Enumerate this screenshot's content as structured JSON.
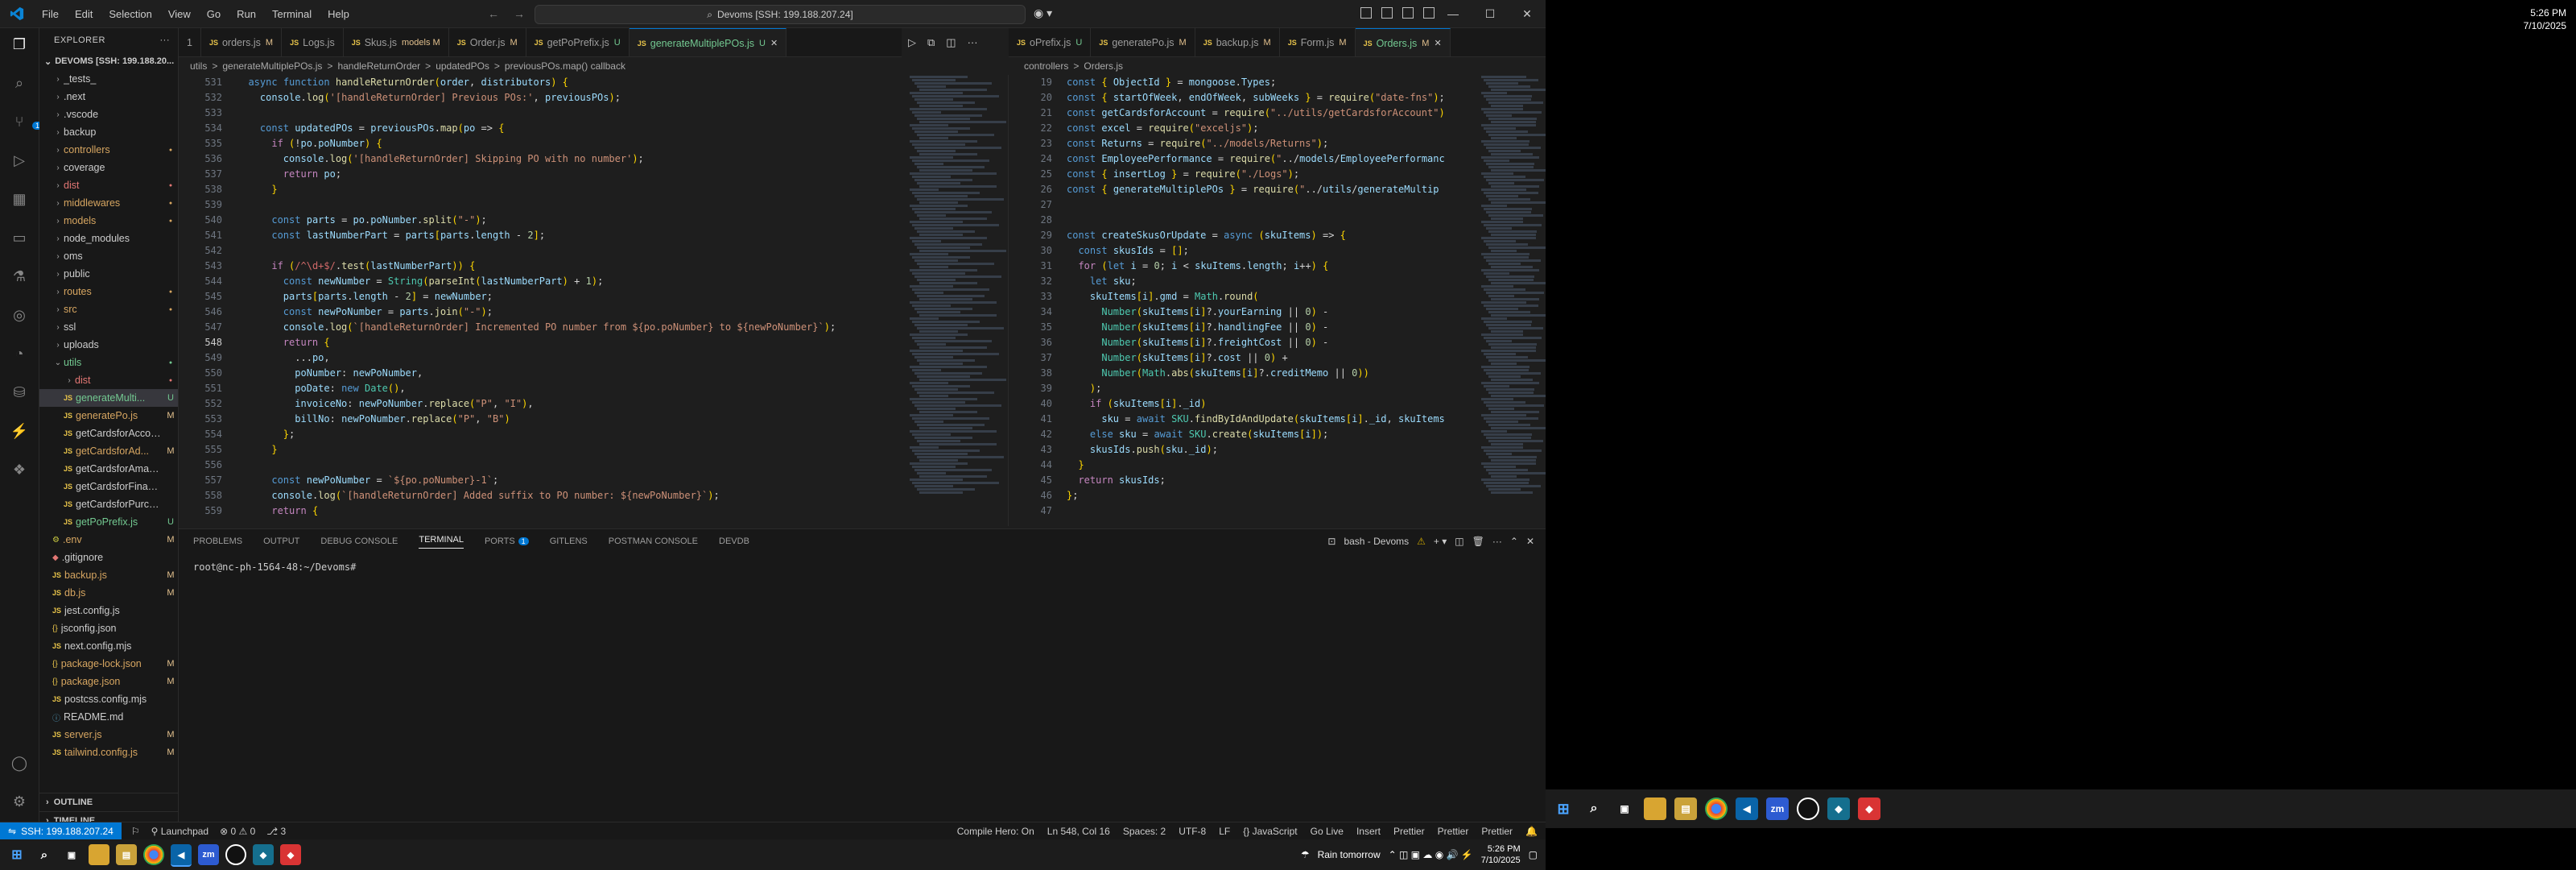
{
  "titlebar": {
    "menu": [
      "File",
      "Edit",
      "Selection",
      "View",
      "Go",
      "Run",
      "Terminal",
      "Help"
    ],
    "command_center": "Devoms [SSH: 199.188.207.24]"
  },
  "activity_badge": "1",
  "explorer": {
    "header": "EXPLORER",
    "root": "DEVOMS [SSH: 199.188.20...",
    "items": [
      {
        "label": "_tests_",
        "type": "folder",
        "status": ""
      },
      {
        "label": ".next",
        "type": "folder",
        "status": ""
      },
      {
        "label": ".vscode",
        "type": "folder",
        "status": ""
      },
      {
        "label": "backup",
        "type": "folder",
        "status": ""
      },
      {
        "label": "controllers",
        "type": "folder",
        "status": "",
        "color": "orange"
      },
      {
        "label": "coverage",
        "type": "folder",
        "status": ""
      },
      {
        "label": "dist",
        "type": "folder",
        "status": "",
        "color": "red"
      },
      {
        "label": "middlewares",
        "type": "folder",
        "status": "",
        "color": "orange"
      },
      {
        "label": "models",
        "type": "folder",
        "status": "",
        "color": "orange"
      },
      {
        "label": "node_modules",
        "type": "folder",
        "status": ""
      },
      {
        "label": "oms",
        "type": "folder",
        "status": ""
      },
      {
        "label": "public",
        "type": "folder",
        "status": ""
      },
      {
        "label": "routes",
        "type": "folder",
        "status": "",
        "color": "orange"
      },
      {
        "label": "src",
        "type": "folder",
        "status": "",
        "color": "orange"
      },
      {
        "label": "ssl",
        "type": "folder",
        "status": ""
      },
      {
        "label": "uploads",
        "type": "folder",
        "status": ""
      },
      {
        "label": "utils",
        "type": "folder",
        "status": "",
        "color": "green",
        "open": true
      },
      {
        "label": "dist",
        "type": "folder",
        "status": "",
        "indent": 1,
        "color": "red"
      },
      {
        "label": "generateMulti...",
        "type": "js",
        "status": "U",
        "indent": 1,
        "selected": true,
        "color": "green"
      },
      {
        "label": "generatePo.js",
        "type": "js",
        "status": "M",
        "indent": 1,
        "color": "orange"
      },
      {
        "label": "getCardsforAccount.js",
        "type": "js",
        "status": "",
        "indent": 1
      },
      {
        "label": "getCardsforAd...",
        "type": "js",
        "status": "M",
        "indent": 1,
        "color": "orange"
      },
      {
        "label": "getCardsforAmazon.js",
        "type": "js",
        "status": "",
        "indent": 1
      },
      {
        "label": "getCardsforFinance.js",
        "type": "js",
        "status": "",
        "indent": 1
      },
      {
        "label": "getCardsforPurchasi...",
        "type": "js",
        "status": "",
        "indent": 1
      },
      {
        "label": "getPoPrefix.js",
        "type": "js",
        "status": "U",
        "indent": 1,
        "color": "green"
      },
      {
        "label": ".env",
        "type": "env",
        "status": "M",
        "color": "orange"
      },
      {
        "label": ".gitignore",
        "type": "git",
        "status": ""
      },
      {
        "label": "backup.js",
        "type": "js",
        "status": "M",
        "color": "orange"
      },
      {
        "label": "db.js",
        "type": "js",
        "status": "M",
        "color": "orange"
      },
      {
        "label": "jest.config.js",
        "type": "js",
        "status": ""
      },
      {
        "label": "jsconfig.json",
        "type": "json",
        "status": ""
      },
      {
        "label": "next.config.mjs",
        "type": "js",
        "status": ""
      },
      {
        "label": "package-lock.json",
        "type": "json",
        "status": "M",
        "color": "orange"
      },
      {
        "label": "package.json",
        "type": "json",
        "status": "M",
        "color": "orange"
      },
      {
        "label": "postcss.config.mjs",
        "type": "js",
        "status": ""
      },
      {
        "label": "README.md",
        "type": "md",
        "status": ""
      },
      {
        "label": "server.js",
        "type": "js",
        "status": "M",
        "color": "orange"
      },
      {
        "label": "tailwind.config.js",
        "type": "js",
        "status": "M",
        "color": "orange"
      }
    ],
    "outline": "OUTLINE",
    "timeline": "TIMELINE"
  },
  "left_editor": {
    "tabs": [
      {
        "label": "1",
        "status": ""
      },
      {
        "label": "orders.js",
        "status": "M"
      },
      {
        "label": "Logs.js",
        "status": ""
      },
      {
        "label": "Skus.js",
        "status": "models M"
      },
      {
        "label": "Order.js",
        "status": "M"
      },
      {
        "label": "getPoPrefix.js",
        "status": "U"
      },
      {
        "label": "generateMultiplePOs.js",
        "status": "U",
        "active": true
      }
    ],
    "breadcrumb": [
      "utils",
      ">",
      "generateMultiplePOs.js",
      ">",
      "handleReturnOrder",
      ">",
      "updatedPOs",
      ">",
      "previousPOs.map() callback"
    ],
    "lines": [
      {
        "n": "531",
        "t": "  async function handleReturnOrder(order, distributors) {"
      },
      {
        "n": "532",
        "t": "    console.log('[handleReturnOrder] Previous POs:', previousPOs);"
      },
      {
        "n": "533",
        "t": ""
      },
      {
        "n": "534",
        "t": "    const updatedPOs = previousPOs.map(po => {"
      },
      {
        "n": "535",
        "t": "      if (!po.poNumber) {"
      },
      {
        "n": "536",
        "t": "        console.log('[handleReturnOrder] Skipping PO with no number');"
      },
      {
        "n": "537",
        "t": "        return po;"
      },
      {
        "n": "538",
        "t": "      }"
      },
      {
        "n": "539",
        "t": ""
      },
      {
        "n": "540",
        "t": "      const parts = po.poNumber.split(\"-\");"
      },
      {
        "n": "541",
        "t": "      const lastNumberPart = parts[parts.length - 2];"
      },
      {
        "n": "542",
        "t": ""
      },
      {
        "n": "543",
        "t": "      if (/^\\d+$/.test(lastNumberPart)) {"
      },
      {
        "n": "544",
        "t": "        const newNumber = String(parseInt(lastNumberPart) + 1);"
      },
      {
        "n": "545",
        "t": "        parts[parts.length - 2] = newNumber;"
      },
      {
        "n": "546",
        "t": "        const newPoNumber = parts.join(\"-\");"
      },
      {
        "n": "547",
        "t": "        console.log(`[handleReturnOrder] Incremented PO number from ${po.poNumber} to ${newPoNumber}`);"
      },
      {
        "n": "548",
        "t": "        return {"
      },
      {
        "n": "549",
        "t": "          ...po,"
      },
      {
        "n": "550",
        "t": "          poNumber: newPoNumber,"
      },
      {
        "n": "551",
        "t": "          poDate: new Date(),"
      },
      {
        "n": "552",
        "t": "          invoiceNo: newPoNumber.replace(\"P\", \"I\"),"
      },
      {
        "n": "553",
        "t": "          billNo: newPoNumber.replace(\"P\", \"B\")"
      },
      {
        "n": "554",
        "t": "        };"
      },
      {
        "n": "555",
        "t": "      }"
      },
      {
        "n": "556",
        "t": ""
      },
      {
        "n": "557",
        "t": "      const newPoNumber = `${po.poNumber}-1`;"
      },
      {
        "n": "558",
        "t": "      console.log(`[handleReturnOrder] Added suffix to PO number: ${newPoNumber}`);"
      },
      {
        "n": "559",
        "t": "      return {"
      }
    ]
  },
  "right_editor": {
    "tabs": [
      {
        "label": "oPrefix.js",
        "status": "U"
      },
      {
        "label": "generatePo.js",
        "status": "M"
      },
      {
        "label": "backup.js",
        "status": "M"
      },
      {
        "label": "Form.js",
        "status": "M"
      },
      {
        "label": "Orders.js",
        "status": "M",
        "active": true
      }
    ],
    "breadcrumb": [
      "controllers",
      ">",
      "Orders.js"
    ],
    "lines": [
      {
        "n": "19",
        "t": "const { ObjectId } = mongoose.Types;"
      },
      {
        "n": "20",
        "t": "const { startOfWeek, endOfWeek, subWeeks } = require(\"date-fns\");"
      },
      {
        "n": "21",
        "t": "const getCardsforAccount = require(\"../utils/getCardsforAccount\")"
      },
      {
        "n": "22",
        "t": "const excel = require(\"exceljs\");"
      },
      {
        "n": "23",
        "t": "const Returns = require(\"../models/Returns\");"
      },
      {
        "n": "24",
        "t": "const EmployeePerformance = require(\"../models/EmployeePerformanc"
      },
      {
        "n": "25",
        "t": "const { insertLog } = require(\"./Logs\");"
      },
      {
        "n": "26",
        "t": "const { generateMultiplePOs } = require(\"../utils/generateMultip"
      },
      {
        "n": "27",
        "t": ""
      },
      {
        "n": "28",
        "t": ""
      },
      {
        "n": "29",
        "t": "const createSkusOrUpdate = async (skuItems) => {"
      },
      {
        "n": "30",
        "t": "  const skusIds = [];"
      },
      {
        "n": "31",
        "t": "  for (let i = 0; i < skuItems.length; i++) {"
      },
      {
        "n": "32",
        "t": "    let sku;"
      },
      {
        "n": "33",
        "t": "    skuItems[i].gmd = Math.round("
      },
      {
        "n": "34",
        "t": "      Number(skuItems[i]?.yourEarning || 0) -"
      },
      {
        "n": "35",
        "t": "      Number(skuItems[i]?.handlingFee || 0) -"
      },
      {
        "n": "36",
        "t": "      Number(skuItems[i]?.freightCost || 0) -"
      },
      {
        "n": "37",
        "t": "      Number(skuItems[i]?.cost || 0) +"
      },
      {
        "n": "38",
        "t": "      Number(Math.abs(skuItems[i]?.creditMemo || 0))"
      },
      {
        "n": "39",
        "t": "    );"
      },
      {
        "n": "40",
        "t": "    if (skuItems[i]._id)"
      },
      {
        "n": "41",
        "t": "      sku = await SKU.findByIdAndUpdate(skuItems[i]._id, skuItems"
      },
      {
        "n": "42",
        "t": "    else sku = await SKU.create(skuItems[i]);"
      },
      {
        "n": "43",
        "t": "    skusIds.push(sku._id);"
      },
      {
        "n": "44",
        "t": "  }"
      },
      {
        "n": "45",
        "t": "  return skusIds;"
      },
      {
        "n": "46",
        "t": "};"
      },
      {
        "n": "47",
        "t": ""
      }
    ]
  },
  "panel": {
    "tabs": [
      "PROBLEMS",
      "OUTPUT",
      "DEBUG CONSOLE",
      "TERMINAL",
      "PORTS",
      "GITLENS",
      "POSTMAN CONSOLE",
      "DEVDB"
    ],
    "ports_badge": "1",
    "active_tab": "TERMINAL",
    "terminal_name": "bash - Devoms",
    "prompt": "root@nc-ph-1564-48:~/Devoms#"
  },
  "statusbar": {
    "remote": "SSH: 199.188.207.24",
    "left": [
      "Launchpad",
      "0 ⚠ 0",
      "3"
    ],
    "right": [
      "Compile Hero: On",
      "Ln 548, Col 16",
      "Spaces: 2",
      "UTF-8",
      "LF",
      "{} JavaScript",
      "Go Live",
      "Insert",
      "Prettier",
      "Prettier",
      "Prettier"
    ]
  },
  "taskbar_left": {
    "weather": "Rain tomorrow",
    "time": "5:26 PM",
    "date": "7/10/2025"
  },
  "taskbar_right": {
    "time": "5:26 PM",
    "date": "7/10/2025"
  }
}
